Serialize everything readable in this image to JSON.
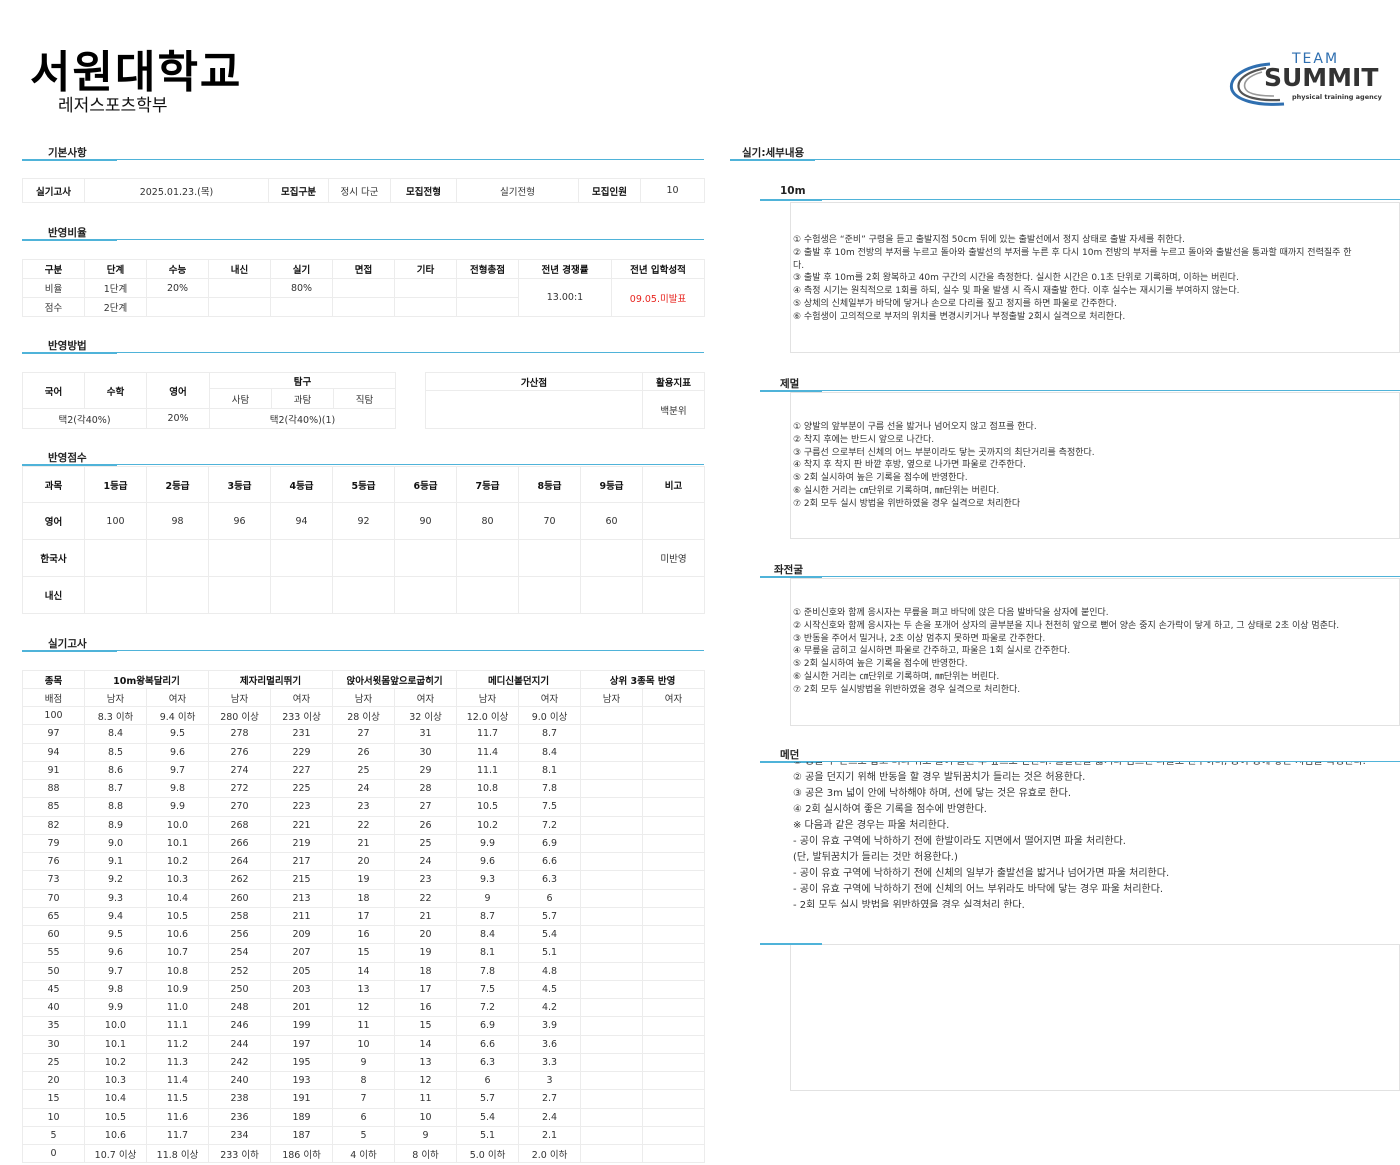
{
  "header": {
    "university": "서원대학교",
    "department": "레저스포츠학부"
  },
  "logo": {
    "line1": "TEAM",
    "line2": "SUMMIT",
    "tagline": "physical training agency",
    "accent": "#2f6fb0"
  },
  "sections": {
    "basic": "기본사항",
    "ratio": "반영비율",
    "method": "반영방법",
    "score": "반영점수",
    "practical": "실기고사",
    "detail": "실기:세부내용"
  },
  "basic": [
    {
      "label": "실기고사",
      "value": "2025.01.23.(목)"
    },
    {
      "label": "모집구분",
      "value": "정시 다군"
    },
    {
      "label": "모집전형",
      "value": "실기전형"
    },
    {
      "label": "모집인원",
      "value": "10"
    }
  ],
  "ratio": {
    "headers": [
      "구분",
      "단계",
      "수능",
      "내신",
      "실기",
      "면접",
      "기타",
      "전형총점",
      "전년 경쟁률",
      "전년 입학성적"
    ],
    "row1": [
      "비율",
      "1단계",
      "20%",
      "",
      "80%",
      "",
      "",
      ""
    ],
    "row2": [
      "점수",
      "2단계",
      "",
      "",
      "",
      "",
      "",
      ""
    ],
    "competition": "13.00:1",
    "entry": "09.05.미발표"
  },
  "method": {
    "headers": [
      "국어",
      "수학",
      "영어",
      "탐구",
      "가산점",
      "활용지표"
    ],
    "sub": [
      "사탐",
      "과탐",
      "직탐"
    ],
    "values": [
      "택2(각40%)",
      "20%",
      "택2(각40%)(1)"
    ],
    "bonus": "",
    "indicator": "백분위"
  },
  "score": {
    "headers": [
      "과목",
      "1등급",
      "2등급",
      "3등급",
      "4등급",
      "5등급",
      "6등급",
      "7등급",
      "8등급",
      "9등급",
      "비고"
    ],
    "rows": [
      [
        "영어",
        "100",
        "98",
        "96",
        "94",
        "92",
        "90",
        "80",
        "70",
        "60",
        ""
      ],
      [
        "한국사",
        "",
        "",
        "",
        "",
        "",
        "",
        "",
        "",
        "",
        "미반영"
      ],
      [
        "내신",
        "",
        "",
        "",
        "",
        "",
        "",
        "",
        "",
        "",
        ""
      ]
    ]
  },
  "practical": {
    "events": [
      "종목",
      "10m왕복달리기",
      "제자리멀리뛰기",
      "앉아서윗몸앞으로굽히기",
      "메디신볼던지기",
      "상위 3종목 반영"
    ],
    "sub": [
      "배점",
      "남자",
      "여자",
      "남자",
      "여자",
      "남자",
      "여자",
      "남자",
      "여자",
      "남자",
      "여자"
    ],
    "rows": [
      [
        "100",
        "8.3 이하",
        "9.4 이하",
        "280 이상",
        "233 이상",
        "28 이상",
        "32 이상",
        "12.0 이상",
        "9.0 이상",
        "",
        ""
      ],
      [
        "97",
        "8.4",
        "9.5",
        "278",
        "231",
        "27",
        "31",
        "11.7",
        "8.7",
        "",
        ""
      ],
      [
        "94",
        "8.5",
        "9.6",
        "276",
        "229",
        "26",
        "30",
        "11.4",
        "8.4",
        "",
        ""
      ],
      [
        "91",
        "8.6",
        "9.7",
        "274",
        "227",
        "25",
        "29",
        "11.1",
        "8.1",
        "",
        ""
      ],
      [
        "88",
        "8.7",
        "9.8",
        "272",
        "225",
        "24",
        "28",
        "10.8",
        "7.8",
        "",
        ""
      ],
      [
        "85",
        "8.8",
        "9.9",
        "270",
        "223",
        "23",
        "27",
        "10.5",
        "7.5",
        "",
        ""
      ],
      [
        "82",
        "8.9",
        "10.0",
        "268",
        "221",
        "22",
        "26",
        "10.2",
        "7.2",
        "",
        ""
      ],
      [
        "79",
        "9.0",
        "10.1",
        "266",
        "219",
        "21",
        "25",
        "9.9",
        "6.9",
        "",
        ""
      ],
      [
        "76",
        "9.1",
        "10.2",
        "264",
        "217",
        "20",
        "24",
        "9.6",
        "6.6",
        "",
        ""
      ],
      [
        "73",
        "9.2",
        "10.3",
        "262",
        "215",
        "19",
        "23",
        "9.3",
        "6.3",
        "",
        ""
      ],
      [
        "70",
        "9.3",
        "10.4",
        "260",
        "213",
        "18",
        "22",
        "9",
        "6",
        "",
        ""
      ],
      [
        "65",
        "9.4",
        "10.5",
        "258",
        "211",
        "17",
        "21",
        "8.7",
        "5.7",
        "",
        ""
      ],
      [
        "60",
        "9.5",
        "10.6",
        "256",
        "209",
        "16",
        "20",
        "8.4",
        "5.4",
        "",
        ""
      ],
      [
        "55",
        "9.6",
        "10.7",
        "254",
        "207",
        "15",
        "19",
        "8.1",
        "5.1",
        "",
        ""
      ],
      [
        "50",
        "9.7",
        "10.8",
        "252",
        "205",
        "14",
        "18",
        "7.8",
        "4.8",
        "",
        ""
      ],
      [
        "45",
        "9.8",
        "10.9",
        "250",
        "203",
        "13",
        "17",
        "7.5",
        "4.5",
        "",
        ""
      ],
      [
        "40",
        "9.9",
        "11.0",
        "248",
        "201",
        "12",
        "16",
        "7.2",
        "4.2",
        "",
        ""
      ],
      [
        "35",
        "10.0",
        "11.1",
        "246",
        "199",
        "11",
        "15",
        "6.9",
        "3.9",
        "",
        ""
      ],
      [
        "30",
        "10.1",
        "11.2",
        "244",
        "197",
        "10",
        "14",
        "6.6",
        "3.6",
        "",
        ""
      ],
      [
        "25",
        "10.2",
        "11.3",
        "242",
        "195",
        "9",
        "13",
        "6.3",
        "3.3",
        "",
        ""
      ],
      [
        "20",
        "10.3",
        "11.4",
        "240",
        "193",
        "8",
        "12",
        "6",
        "3",
        "",
        ""
      ],
      [
        "15",
        "10.4",
        "11.5",
        "238",
        "191",
        "7",
        "11",
        "5.7",
        "2.7",
        "",
        ""
      ],
      [
        "10",
        "10.5",
        "11.6",
        "236",
        "189",
        "6",
        "10",
        "5.4",
        "2.4",
        "",
        ""
      ],
      [
        "5",
        "10.6",
        "11.7",
        "234",
        "187",
        "5",
        "9",
        "5.1",
        "2.1",
        "",
        ""
      ],
      [
        "0",
        "10.7 이상",
        "11.8 이상",
        "233 이하",
        "186 이하",
        "4 이하",
        "8 이하",
        "5.0 이하",
        "2.0 이하",
        "",
        ""
      ]
    ]
  },
  "detail": [
    {
      "title": "10m",
      "lines": [
        "① 수험생은 “준비” 구령을 듣고 출발지점 50cm 뒤에 있는 출발선에서 정지 상태로 출발 자세를 취한다.",
        "② 출발 후 10m 전방의 부저를 누르고 돌아와 출발선의 부저를 누른 후 다시 10m 전방의 부저를 누르고 돌아와 출발선을 통과할 때까지 전력질주 한",
        "다.",
        "③ 출발 후 10m를 2회 왕복하고 40m 구간의 시간을 측정한다. 실시한 시간은 0.1초 단위로 기록하며, 이하는 버린다.",
        "④ 측정 시기는 원칙적으로 1회를 하되, 실수 및 파울 발생 시 즉시 재출발 한다. 이후 실수는 재시기를 부여하지 않는다.",
        "⑤ 상체의 신체일부가 바닥에 닿거나 손으로 다리를 짚고 정지를 하면 파울로 간주한다.",
        "⑥ 수험생이 고의적으로 부저의 위치를 변경시키거나 부정출발 2회시 실격으로 처리한다."
      ]
    },
    {
      "title": "제멀",
      "lines": [
        "① 양발의 앞부분이 구름 선을 밟거나 넘어오지 않고 점프를 한다.",
        "② 착지 후에는 반드시 앞으로 나간다.",
        "③ 구름선 으로부터 신체의 어느 부분이라도 닿는 곳까지의 최단거리를 측정한다.",
        "④ 착지 후 착지 판 바깥 후방, 옆으로 나가면 파울로 간주한다.",
        "⑤ 2회 실시하여 높은 기록을 점수에 반영한다.",
        "⑥ 실시한 거리는 ㎝단위로 기록하며, ㎜단위는 버린다.",
        "⑦ 2회 모두 실시 방법을 위반하였을 경우 실격으로 처리한다"
      ]
    },
    {
      "title": "좌전굴",
      "lines": [
        "① 준비신호와 함께 응시자는 무릎을 펴고 바닥에 앉은 다음 발바닥을 상자에 붙인다.",
        "② 시작신호와 함께 응시자는 두 손을 포개어 상자의 골부분을 지나 천천히 앞으로 뻗어 양손 중지 손가락이 닿게 하고, 그 상태로 2초 이상 멈춘다.",
        "③ 반동을 주어서 밀거나, 2초 이상 멈추지 못하면 파울로 간주한다.",
        "④ 무릎을 굽히고 실시하면 파울로 간주하고, 파울은 1회 실시로 간주한다.",
        "⑤ 2회 실시하여 높은 기록을 점수에 반영한다.",
        "⑥ 실시한 거리는 ㎝단위로 기록하며, ㎜단위는 버린다.",
        "⑦ 2회 모두 실시방법을 위반하였을 경우 실격으로 처리한다."
      ]
    },
    {
      "title": "메던",
      "lines": [
        "① 공을 두 손으로 잡고 머리 위로 들어 올린 후 앞으로 던진다. 출발선을 밟거나 넘으면 파울로 간주하며, 공이 땅에 닿는 지점을 측정한다.",
        "② 공을 던지기 위해 반동을 할 경우 발뒤꿈치가 들리는 것은 허용한다.",
        "③ 공은 3m 넓이 안에 낙하해야 하며, 선에 닿는 것은 유효로 한다.",
        "④ 2회 실시하여 좋은 기록을 점수에 반영한다.",
        "※ 다음과 같은 경우는 파울 처리한다.",
        "- 공이 유효 구역에 낙하하기 전에 한발이라도 지면에서 떨어지면 파울 처리한다.",
        "(단, 발뒤꿈치가 들리는 것만 허용한다.)",
        "- 공이 유효 구역에 낙하하기 전에 신체의 일부가 출발선을 밟거나 넘어가면 파울 처리한다.",
        "- 공이 유효 구역에 낙하하기 전에 신체의 어느 부위라도 바닥에 닿는 경우 파울 처리한다.",
        "- 2회 모두 실시 방법을 위반하였을 경우 실격처리 한다."
      ]
    }
  ]
}
